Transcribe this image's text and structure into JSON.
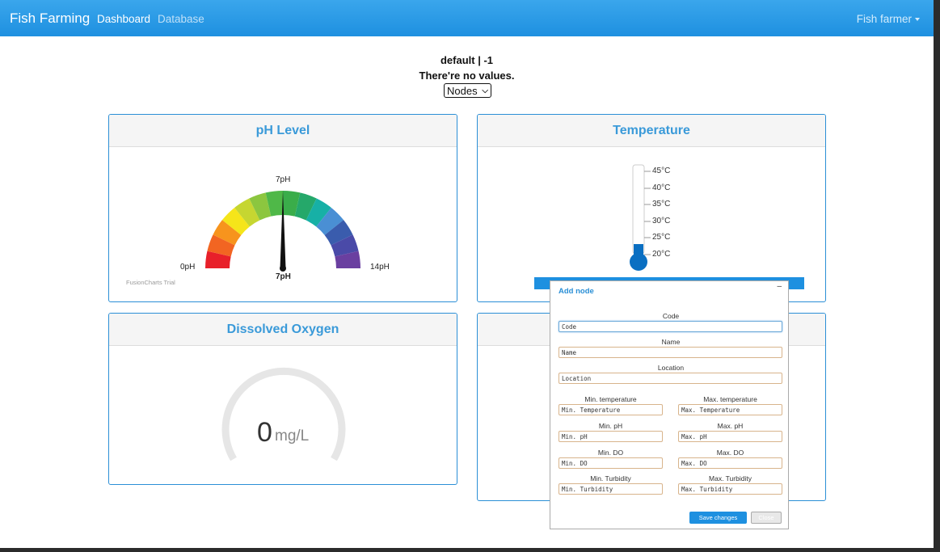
{
  "nav": {
    "brand": "Fish Farming",
    "links": [
      "Dashboard",
      "Database"
    ],
    "user": "Fish farmer"
  },
  "status": {
    "node_line": "default | -1",
    "message": "There're no values.",
    "select_value": "Nodes"
  },
  "cards": {
    "ph": {
      "title": "pH Level",
      "top_label": "7pH",
      "min_label": "0pH",
      "max_label": "14pH",
      "value_label": "7pH",
      "trial": "FusionCharts Trial",
      "value": 7,
      "min": 0,
      "max": 14
    },
    "temp": {
      "title": "Temperature",
      "ticks": [
        "45°C",
        "40°C",
        "35°C",
        "30°C",
        "25°C",
        "20°C"
      ],
      "fill_color": "#0a6fc2"
    },
    "do": {
      "title": "Dissolved Oxygen",
      "value": "0",
      "unit": "mg/L"
    }
  },
  "modal": {
    "title": "Add node",
    "close": "–",
    "fields": {
      "code": {
        "label": "Code",
        "placeholder": "Code"
      },
      "name": {
        "label": "Name",
        "placeholder": "Name"
      },
      "location": {
        "label": "Location",
        "placeholder": "Location"
      },
      "min_temp": {
        "label": "Min. temperature",
        "placeholder": "Min. Temperature"
      },
      "max_temp": {
        "label": "Max. temperature",
        "placeholder": "Max. Temperature"
      },
      "min_ph": {
        "label": "Min. pH",
        "placeholder": "Min. pH"
      },
      "max_ph": {
        "label": "Max. pH",
        "placeholder": "Max. pH"
      },
      "min_do": {
        "label": "Min. DO",
        "placeholder": "Min. DO"
      },
      "max_do": {
        "label": "Max. DO",
        "placeholder": "Max. DO"
      },
      "min_turb": {
        "label": "Min. Turbidity",
        "placeholder": "Min. Turbidity"
      },
      "max_turb": {
        "label": "Max. Turbidity",
        "placeholder": "Max. Turbidity"
      }
    },
    "save_label": "Save changes",
    "close_label": "Close"
  },
  "colors": {
    "accent": "#1e90e0",
    "card_border": "#2b8fd6",
    "gauge_segments": [
      "#e8202a",
      "#f26522",
      "#f7941d",
      "#f5e51a",
      "#c6d631",
      "#8cc63f",
      "#4fb848",
      "#3aad4a",
      "#25a86a",
      "#17b0a6",
      "#4a8fd4",
      "#3a5cad",
      "#4a4aa8",
      "#6a3fa0"
    ]
  }
}
